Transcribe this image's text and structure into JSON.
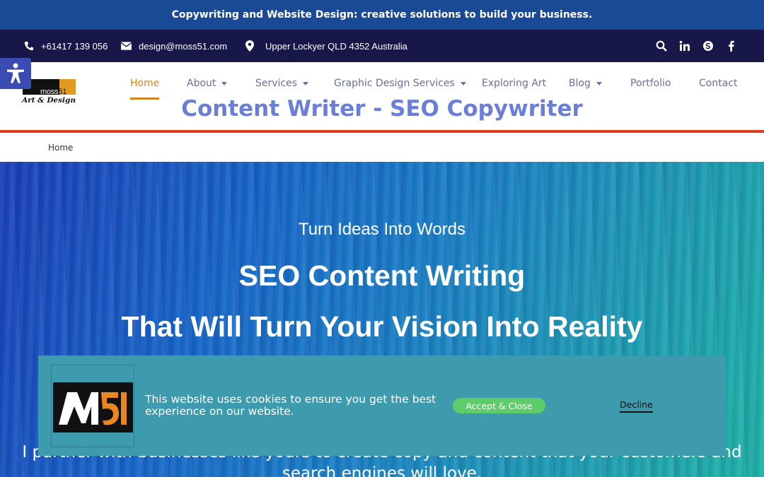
{
  "announcement": "Copywriting and Website Design: creative solutions to build your business.",
  "contact": {
    "phone": "+61417 139 056",
    "email": "design@moss51.com",
    "address": "Upper Lockyer QLD 4352 Australia"
  },
  "socials": [
    "search-icon",
    "linkedin-icon",
    "skype-icon",
    "facebook-icon"
  ],
  "logo": {
    "brand": "moss51",
    "tagline": "Art & Design"
  },
  "nav": {
    "items": [
      {
        "label": "Home",
        "active": true
      },
      {
        "label": "About",
        "dropdown": true
      },
      {
        "label": "Services",
        "dropdown": true
      },
      {
        "label": "Graphic Design Services",
        "dropdown": true
      },
      {
        "label": "Exploring Art"
      },
      {
        "label": "Blog",
        "dropdown": true
      },
      {
        "label": "Portfolio"
      },
      {
        "label": "Contact"
      }
    ]
  },
  "site_title": "Content Writer - SEO Copywriter",
  "breadcrumb": "Home",
  "hero": {
    "subtitle": "Turn Ideas Into Words",
    "heading1": "SEO Content Writing",
    "heading2": "That Will Turn Your Vision Into Reality",
    "body": "I partner with businesses like yours to create copy and content that your customers and search engines will love."
  },
  "cookie": {
    "message": "This website uses cookies to ensure you get the best experience on our website.",
    "accept_label": "Accept & Close",
    "decline_label": "Decline"
  },
  "colors": {
    "announcement_bg": "#1a4a95",
    "contact_bg": "#17174a",
    "accent_orange": "#d4851e",
    "header_border": "#e43b1e",
    "title_blue": "#6b7fd8",
    "cookie_bg": "#3e9aad",
    "accept_green": "#5fcc6a"
  }
}
